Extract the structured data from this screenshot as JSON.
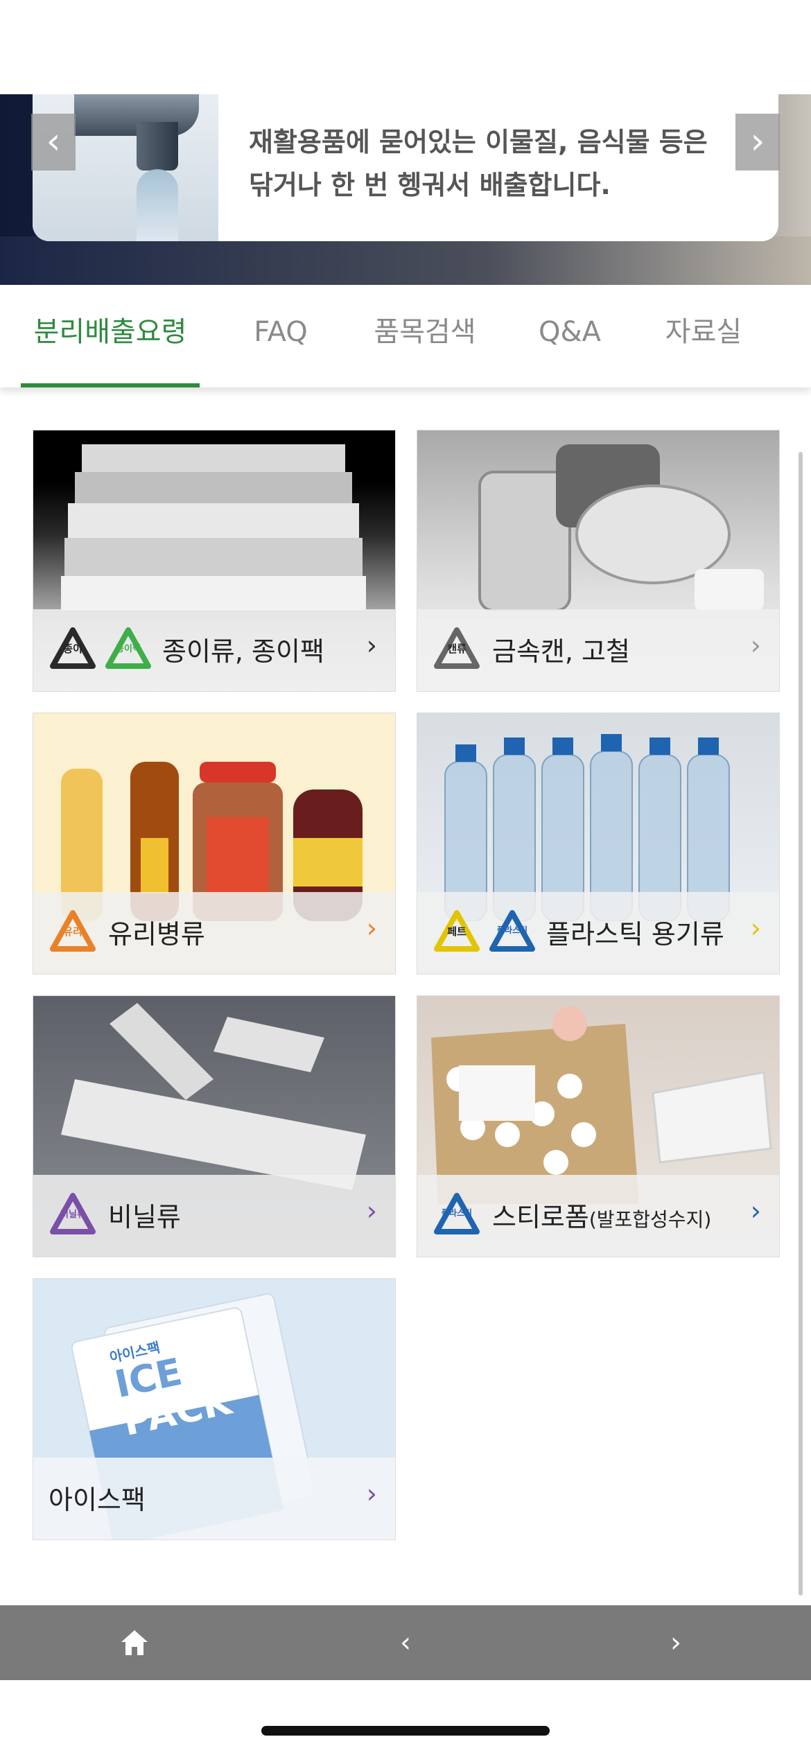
{
  "banner": {
    "text": "재활용품에 묻어있는 이물질, 음식물 등은\n닦거나 한 번 헹궈서 배출합니다.",
    "prev_icon": "‹",
    "next_icon": "›"
  },
  "tabs": [
    {
      "label": "분리배출요령",
      "active": true
    },
    {
      "label": "FAQ",
      "active": false
    },
    {
      "label": "품목검색",
      "active": false
    },
    {
      "label": "Q&A",
      "active": false
    },
    {
      "label": "자료실",
      "active": false
    }
  ],
  "categories": [
    {
      "label": "종이류, 종이팩",
      "icons": [
        {
          "text": "종이",
          "color": "#2a2a2a"
        },
        {
          "text": "종이팩",
          "color": "#3fae49"
        }
      ],
      "chevron_color": "#333333"
    },
    {
      "label": "금속캔, 고철",
      "icons": [
        {
          "text": "캔류",
          "color": "#666666"
        }
      ],
      "chevron_color": "#999999"
    },
    {
      "label": "유리병류",
      "icons": [
        {
          "text": "유리",
          "color": "#e8822a"
        }
      ],
      "chevron_color": "#e8822a"
    },
    {
      "label": "플라스틱 용기류",
      "icons": [
        {
          "text": "페트",
          "color": "#e2c500"
        },
        {
          "text": "플라스틱",
          "color": "#1f64b0"
        }
      ],
      "chevron_color": "#e2c500"
    },
    {
      "label": "비닐류",
      "icons": [
        {
          "text": "비닐류",
          "color": "#7a4fa8"
        }
      ],
      "chevron_color": "#7a4fa8"
    },
    {
      "label": "스티로폼",
      "sub": "(발포합성수지)",
      "icons": [
        {
          "text": "플라스틱",
          "color": "#1f64b0"
        }
      ],
      "chevron_color": "#1f64b0"
    },
    {
      "label": "아이스팩",
      "icons": [],
      "chevron_color": "#7a4fa8"
    }
  ],
  "ice_pack_text": {
    "brand": "아이스팩",
    "line1": "ICE",
    "line2": "PACK"
  },
  "bottom_nav": {
    "home_icon": "⌂",
    "back_icon": "‹",
    "forward_icon": "›"
  },
  "colors": {
    "accent": "#2f8a3e",
    "nav_bg": "#7a7a7a"
  }
}
